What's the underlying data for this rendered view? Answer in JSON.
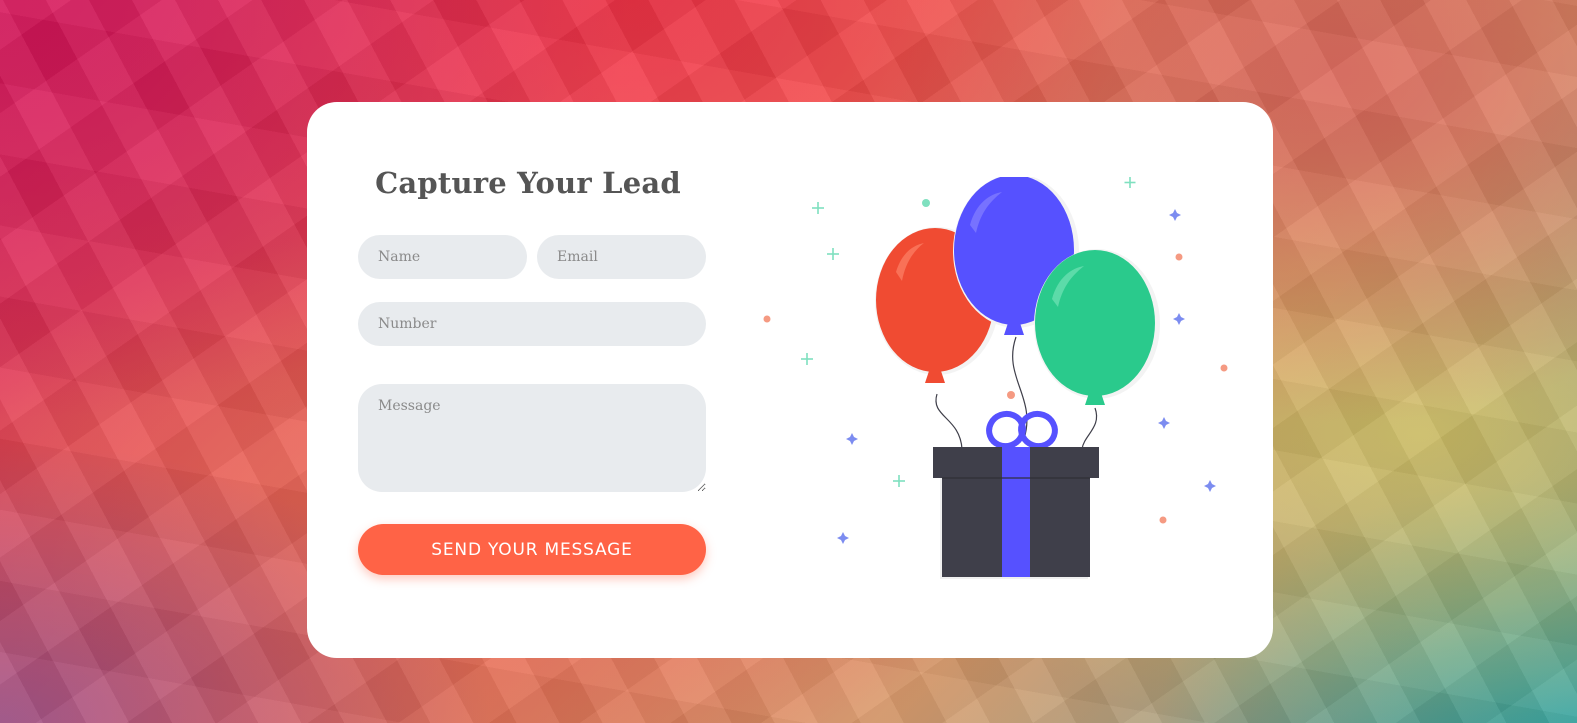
{
  "form": {
    "title": "Capture Your Lead",
    "name_placeholder": "Name",
    "email_placeholder": "Email",
    "number_placeholder": "Number",
    "message_placeholder": "Message",
    "submit_label": "SEND YOUR MESSAGE"
  },
  "colors": {
    "accent": "#ff6346",
    "field_bg": "#e8ebee",
    "title": "#555555",
    "balloon_red": "#f04b32",
    "balloon_blue": "#5651ff",
    "balloon_green": "#2aca8c",
    "gift_box": "#3f3f4a",
    "ribbon": "#5651ff"
  },
  "illustration": {
    "subject": "balloons-and-gift-box",
    "icons": [
      "balloon-red-icon",
      "balloon-blue-icon",
      "balloon-green-icon",
      "gift-box-icon",
      "confetti"
    ]
  }
}
